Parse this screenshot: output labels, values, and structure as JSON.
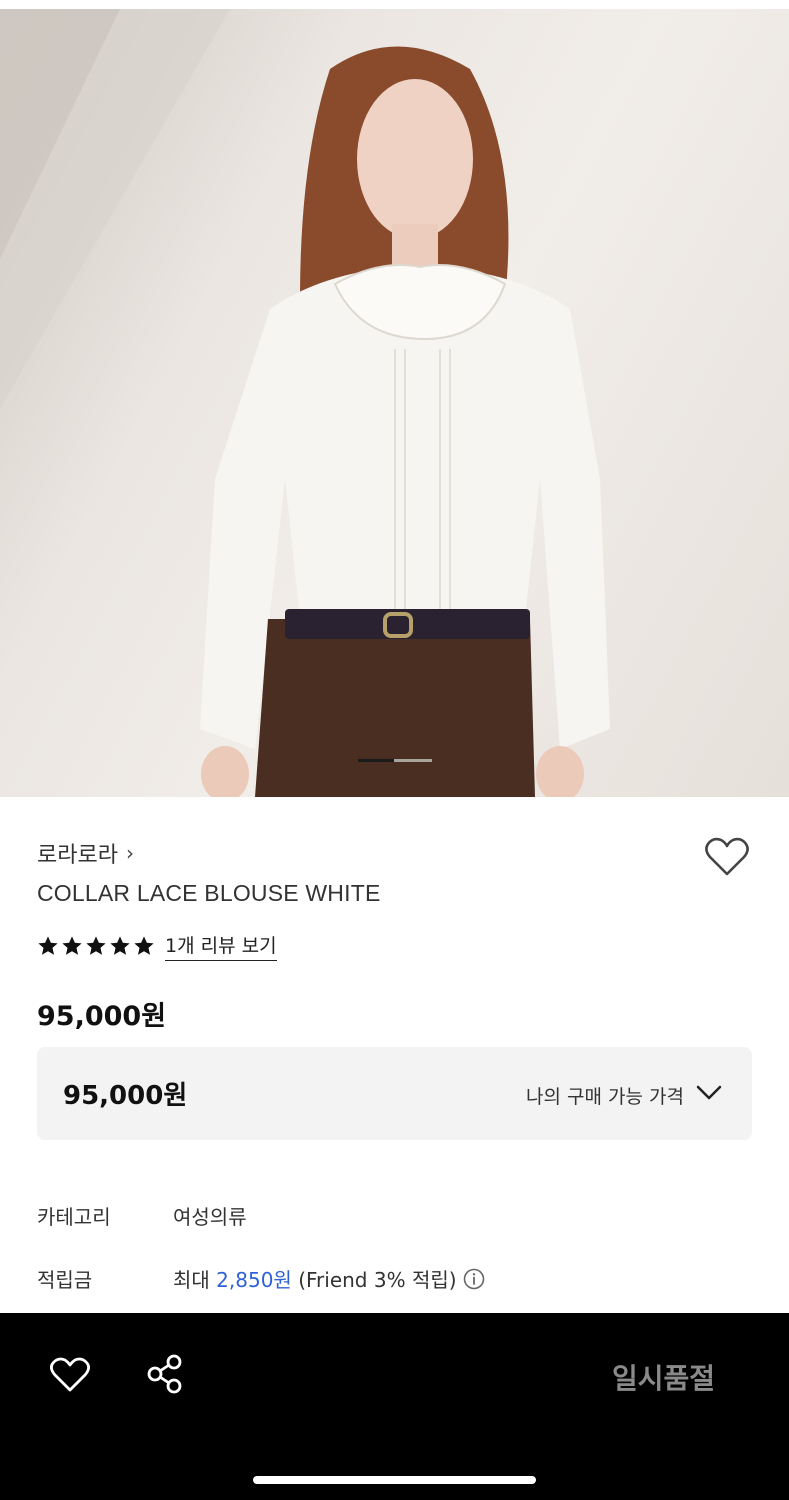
{
  "product": {
    "brand": "로라로라",
    "brand_chevron": "›",
    "name": "COLLAR LACE BLOUSE WHITE",
    "rating_stars": 5,
    "review_link": "1개 리뷰 보기",
    "price": "95,000원"
  },
  "purchase_price": {
    "amount": "95,000원",
    "label": "나의 구매 가능 가격"
  },
  "details": {
    "category_key": "카테고리",
    "category_value": "여성의류",
    "points_key": "적립금",
    "points_prefix": "최대",
    "points_amount": "2,850원",
    "points_suffix": "(Friend 3% 적립)"
  },
  "image_carousel": {
    "current": 1,
    "total": 2
  },
  "bottom_bar": {
    "sold_out_label": "일시품절"
  },
  "colors": {
    "accent_blue": "#2f62d6",
    "bottom_bar": "#000000",
    "price_box_bg": "#f3f3f3",
    "sold_out_text": "#8a8a8a"
  },
  "icons": {
    "favorite": "heart-outline-icon",
    "share": "share-icon",
    "dropdown": "chevron-down-icon",
    "info": "info-circle-icon",
    "star": "star-filled-icon"
  }
}
